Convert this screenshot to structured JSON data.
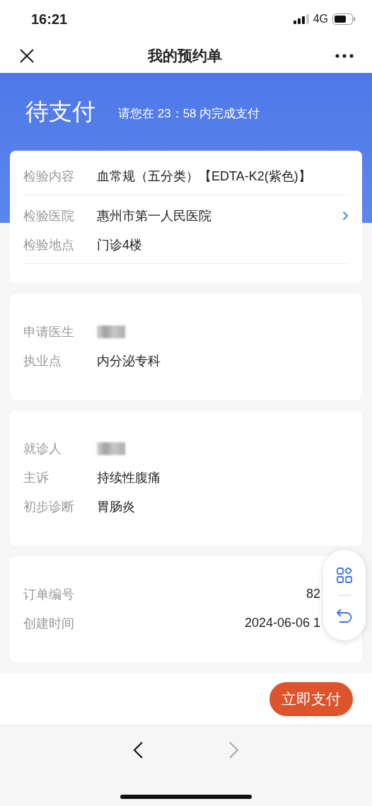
{
  "status_bar": {
    "time": "16:21",
    "network": "4G"
  },
  "nav_bar": {
    "title": "我的预约单"
  },
  "banner": {
    "status": "待支付",
    "notice": "请您在 23：58 内完成支付"
  },
  "sections": [
    {
      "rows": [
        {
          "kind": "text",
          "label": "检验内容",
          "value": "血常规（五分类）【EDTA-K2(紫色)】",
          "divider_after": true
        },
        {
          "kind": "link",
          "label": "检验医院",
          "value": "惠州市第一人民医院"
        },
        {
          "kind": "text",
          "label": "检验地点",
          "value": "门诊4楼",
          "divider_after": true
        }
      ]
    },
    {
      "rows": [
        {
          "kind": "redacted",
          "label": "申请医生"
        },
        {
          "kind": "text",
          "label": "执业点",
          "value": "内分泌专科"
        }
      ]
    },
    {
      "rows": [
        {
          "kind": "redacted",
          "label": "就诊人"
        },
        {
          "kind": "text",
          "label": "主诉",
          "value": "持续性腹痛"
        },
        {
          "kind": "text",
          "label": "初步诊断",
          "value": "胃肠炎"
        }
      ]
    },
    {
      "rows": [
        {
          "kind": "right",
          "label": "订单编号",
          "value": "82"
        },
        {
          "kind": "right",
          "label": "创建时间",
          "value": "2024-06-06 1"
        }
      ]
    }
  ],
  "pay_button": "立即支付",
  "browser_bar": {
    "back": {
      "disabled": false
    },
    "forward": {
      "disabled": true
    }
  }
}
